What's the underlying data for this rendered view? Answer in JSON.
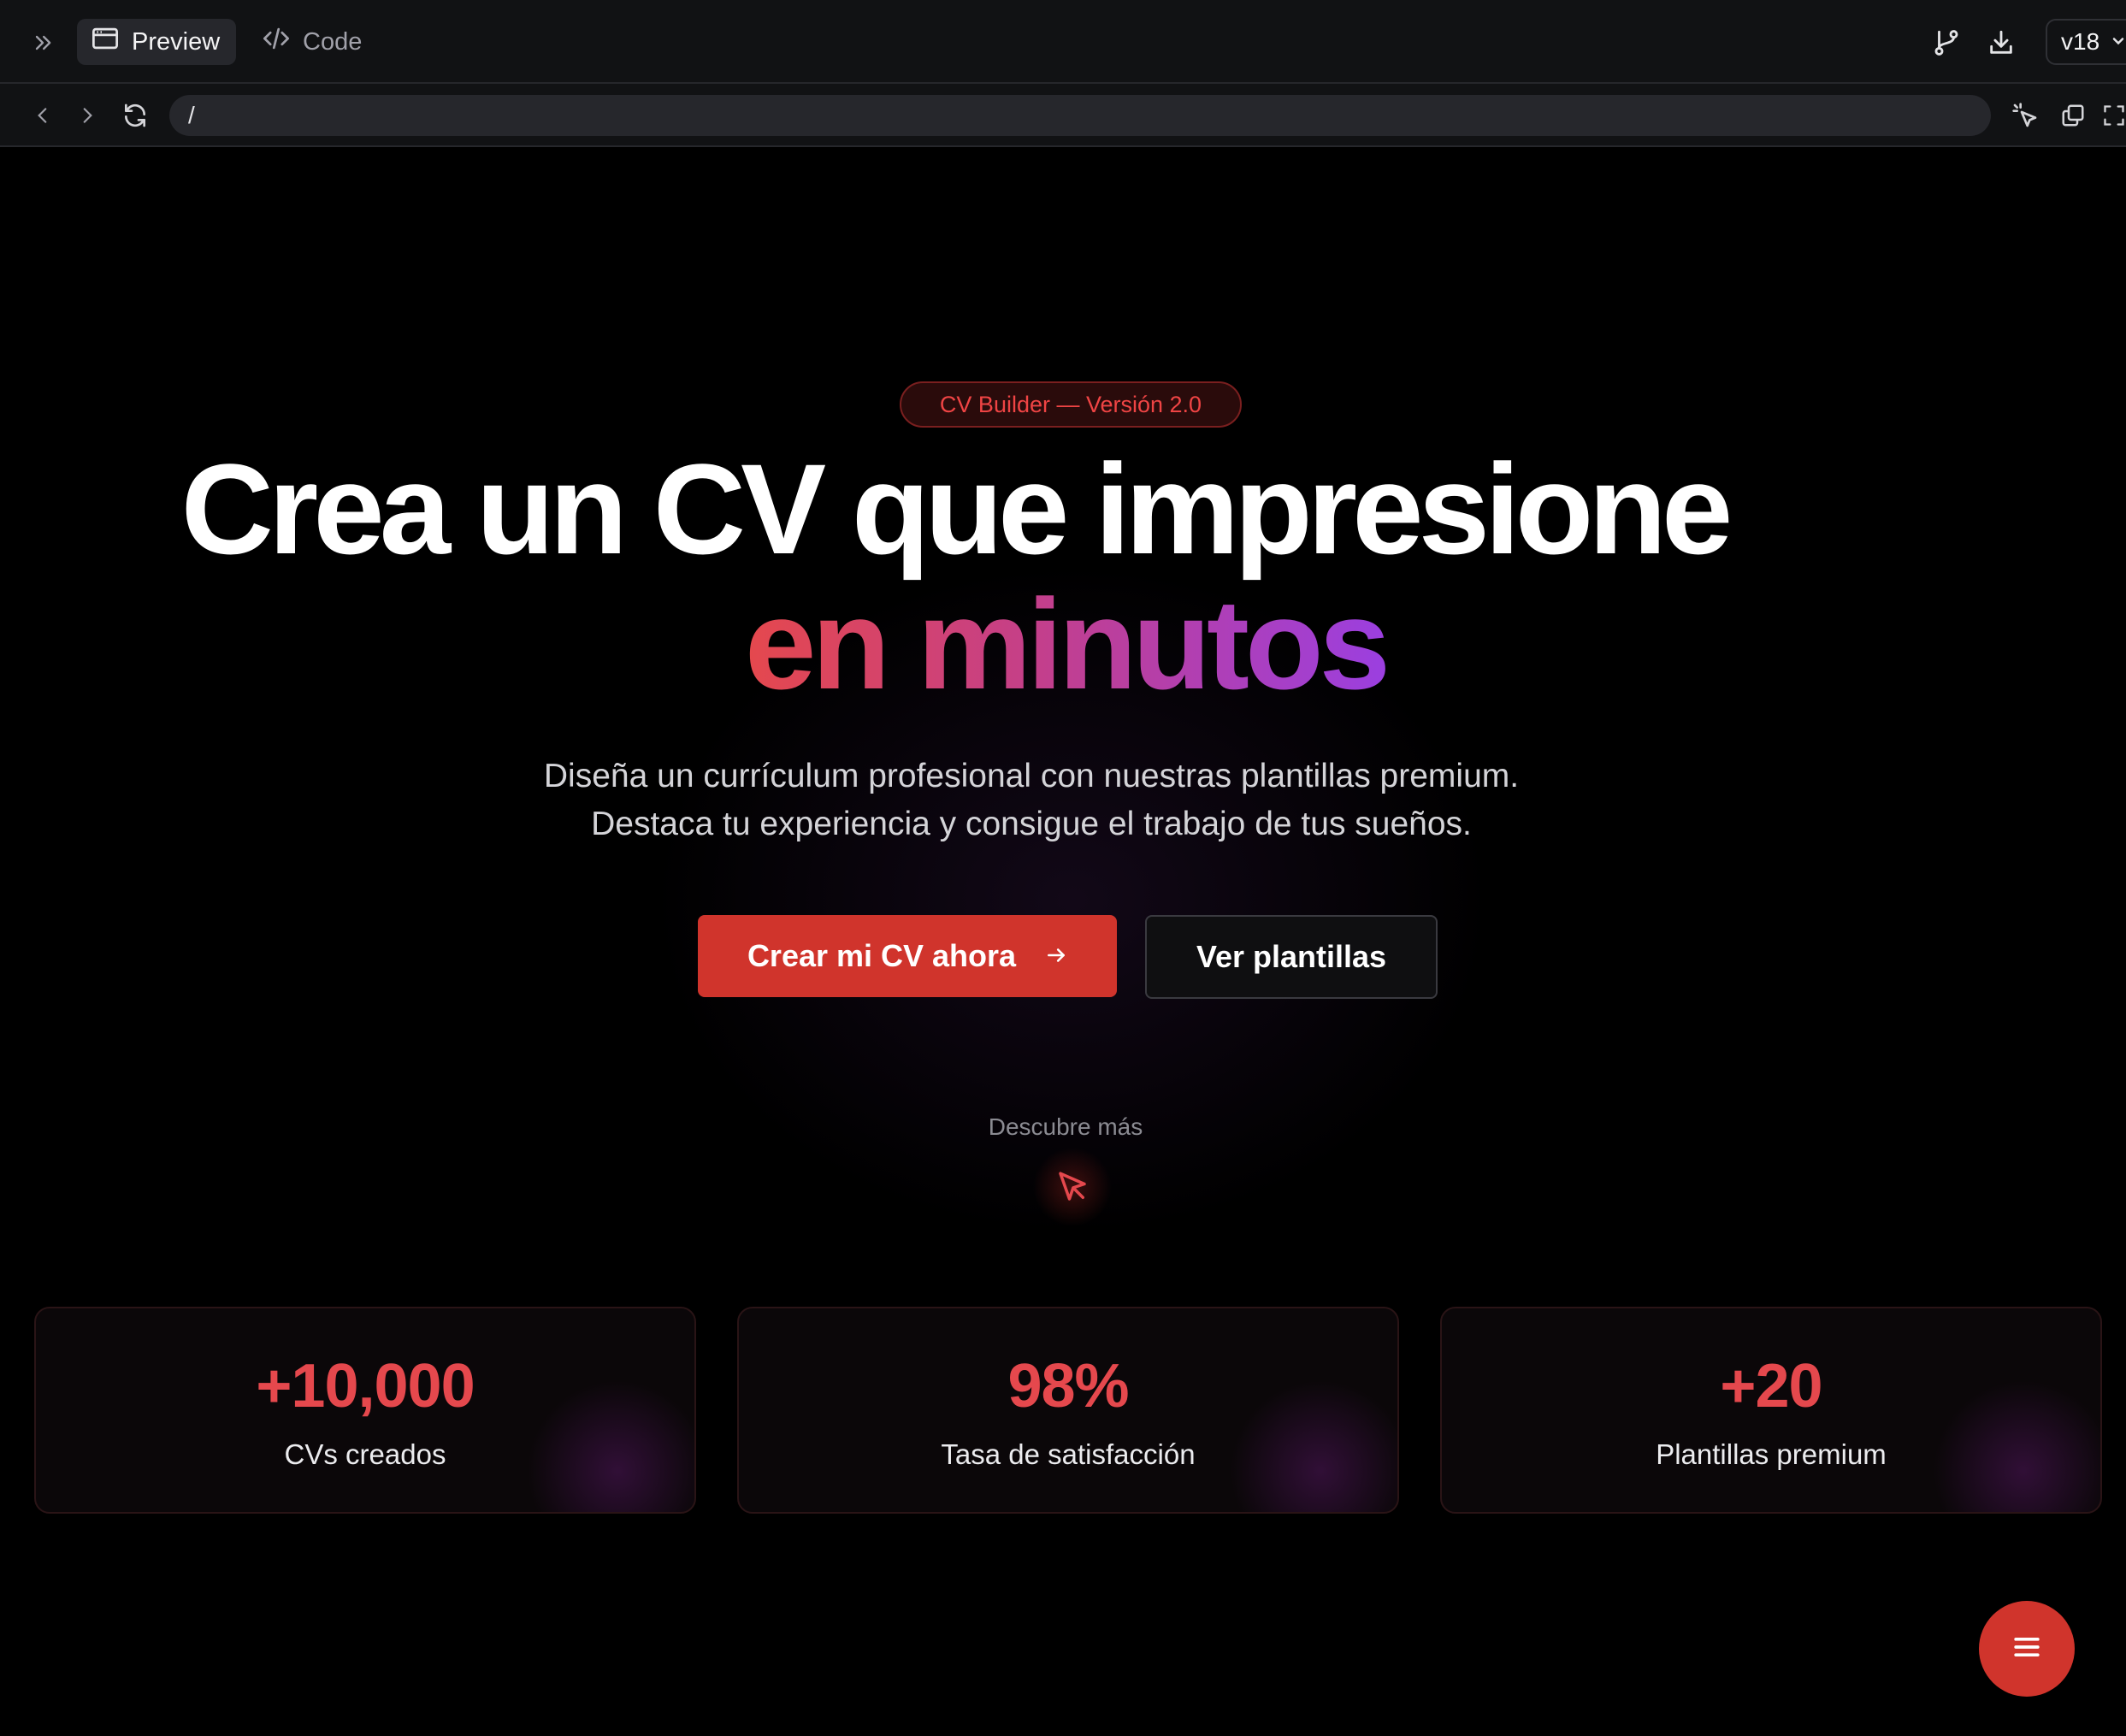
{
  "toolbar": {
    "tabs": [
      {
        "label": "Preview",
        "icon": "browser-window-icon"
      },
      {
        "label": "Code",
        "icon": "code-icon"
      }
    ],
    "version": "v18"
  },
  "address_bar": {
    "url": "/"
  },
  "hero": {
    "badge": "CV Builder — Versión 2.0",
    "title_line1": "Crea un CV que impresione",
    "title_line2": "en minutos",
    "subtitle_line1": "Diseña un currículum profesional con nuestras plantillas premium.",
    "subtitle_line2": "Destaca tu experiencia y consigue el trabajo de tus sueños.",
    "primary_cta": "Crear mi CV ahora",
    "secondary_cta": "Ver plantillas",
    "discover": "Descubre más"
  },
  "stats": [
    {
      "value": "+10,000",
      "label": "CVs creados"
    },
    {
      "value": "98%",
      "label": "Tasa de satisfacción"
    },
    {
      "value": "+20",
      "label": "Plantillas premium"
    }
  ],
  "colors": {
    "accent": "#d0342c",
    "accent_text": "#e5484d",
    "gradient_start": "#e5484d",
    "gradient_end": "#9b3fe0",
    "background": "#000000"
  }
}
